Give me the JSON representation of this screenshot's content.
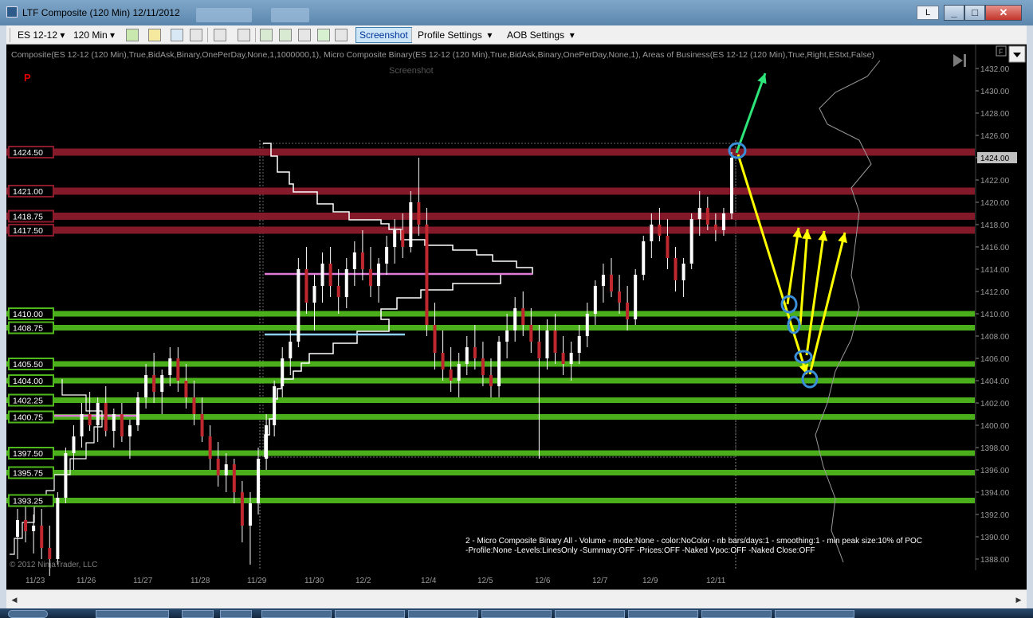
{
  "window": {
    "title": "LTF Composite (120 Min)  12/11/2012",
    "workspace_label": "L"
  },
  "toolbar": {
    "instrument": "ES 12-12",
    "interval": "120 Min",
    "screenshot": "Screenshot",
    "profile_settings": "Profile Settings",
    "aob_settings": "AOB Settings"
  },
  "chart": {
    "indicator_text": "Composite(ES 12-12 (120 Min),True,BidAsk,Binary,OnePerDay,None,1,1000000,1), Micro Composite Binary(ES 12-12 (120 Min),True,BidAsk,Binary,OnePerDay,None,1), Areas of Business(ES 12-12 (120 Min),True,Right,EStxt,False)",
    "tooltip_ghost": "Screenshot",
    "copyright": "© 2012 NinjaTrader, LLC",
    "note_line1": "2 - Micro Composite Binary All - Volume - mode:None  - color:NoColor - nb bars/days:1 - smoothing:1 - min peak size:10% of POC",
    "note_line2": "-Profile:None -Levels:LinesOnly -Summary:OFF -Prices:OFF -Naked Vpoc:OFF -Naked Close:OFF",
    "p_marker": "P",
    "panel_button": "F",
    "colors": {
      "resistance": "#8b1a2b",
      "support": "#4fb81c",
      "up_arrow": "#2ee57a",
      "yellow_arrow": "#ffff00",
      "circle": "#3a8fd8",
      "poc_pink": "#e07ad8",
      "poc_blue": "#8fd0f0"
    }
  },
  "chart_data": {
    "type": "candlestick",
    "yaxis": {
      "min": 1387,
      "max": 1432,
      "ticks": [
        "1432.00",
        "1430.00",
        "1428.00",
        "1426.00",
        "1424.00",
        "1422.00",
        "1420.00",
        "1418.00",
        "1416.00",
        "1414.00",
        "1412.00",
        "1410.00",
        "1408.00",
        "1406.00",
        "1404.00",
        "1402.00",
        "1400.00",
        "1398.00",
        "1396.00",
        "1394.00",
        "1392.00",
        "1390.00",
        "1388.00"
      ]
    },
    "current_price": "1424.00",
    "xaxis": {
      "labels": [
        "11/23",
        "11/26",
        "11/27",
        "11/28",
        "11/29",
        "11/30",
        "12/2",
        "12/4",
        "12/5",
        "12/6",
        "12/7",
        "12/9",
        "12/11"
      ]
    },
    "resistance_levels": [
      {
        "label": "1424.50",
        "value": 1424.5
      },
      {
        "label": "1421.00",
        "value": 1421.0
      },
      {
        "label": "1418.75",
        "value": 1418.75
      },
      {
        "label": "1417.50",
        "value": 1417.5
      }
    ],
    "support_levels": [
      {
        "label": "1410.00",
        "value": 1410.0
      },
      {
        "label": "1408.75",
        "value": 1408.75
      },
      {
        "label": "1405.50",
        "value": 1405.5
      },
      {
        "label": "1404.00",
        "value": 1404.0
      },
      {
        "label": "1402.25",
        "value": 1402.25
      },
      {
        "label": "1400.75",
        "value": 1400.75
      },
      {
        "label": "1397.50",
        "value": 1397.5
      },
      {
        "label": "1395.75",
        "value": 1395.75
      },
      {
        "label": "1393.25",
        "value": 1393.25
      }
    ],
    "candles": [
      {
        "o": 1390.0,
        "h": 1392.5,
        "l": 1388.0,
        "c": 1391.5
      },
      {
        "o": 1391.5,
        "h": 1393.0,
        "l": 1389.5,
        "c": 1390.5
      },
      {
        "o": 1390.5,
        "h": 1392.0,
        "l": 1388.5,
        "c": 1391.0
      },
      {
        "o": 1391.0,
        "h": 1392.5,
        "l": 1388.0,
        "c": 1389.0
      },
      {
        "o": 1389.0,
        "h": 1391.0,
        "l": 1386.5,
        "c": 1388.0
      },
      {
        "o": 1388.0,
        "h": 1394.0,
        "l": 1387.5,
        "c": 1393.5
      },
      {
        "o": 1393.5,
        "h": 1398.0,
        "l": 1393.0,
        "c": 1397.5
      },
      {
        "o": 1397.5,
        "h": 1400.0,
        "l": 1396.0,
        "c": 1399.0
      },
      {
        "o": 1399.0,
        "h": 1402.0,
        "l": 1398.0,
        "c": 1401.0
      },
      {
        "o": 1401.0,
        "h": 1403.0,
        "l": 1399.5,
        "c": 1400.0
      },
      {
        "o": 1400.0,
        "h": 1402.5,
        "l": 1398.5,
        "c": 1402.0
      },
      {
        "o": 1402.0,
        "h": 1403.5,
        "l": 1399.0,
        "c": 1399.5
      },
      {
        "o": 1399.5,
        "h": 1401.5,
        "l": 1398.0,
        "c": 1401.0
      },
      {
        "o": 1401.0,
        "h": 1402.0,
        "l": 1398.5,
        "c": 1399.0
      },
      {
        "o": 1399.0,
        "h": 1400.5,
        "l": 1397.0,
        "c": 1400.0
      },
      {
        "o": 1400.0,
        "h": 1403.0,
        "l": 1399.5,
        "c": 1402.5
      },
      {
        "o": 1402.5,
        "h": 1405.5,
        "l": 1401.5,
        "c": 1404.5
      },
      {
        "o": 1404.5,
        "h": 1406.5,
        "l": 1402.0,
        "c": 1403.0
      },
      {
        "o": 1403.0,
        "h": 1405.0,
        "l": 1401.0,
        "c": 1404.5
      },
      {
        "o": 1404.5,
        "h": 1407.0,
        "l": 1403.5,
        "c": 1406.0
      },
      {
        "o": 1406.0,
        "h": 1407.0,
        "l": 1403.0,
        "c": 1404.0
      },
      {
        "o": 1404.0,
        "h": 1405.5,
        "l": 1401.5,
        "c": 1402.5
      },
      {
        "o": 1402.5,
        "h": 1404.0,
        "l": 1400.0,
        "c": 1401.0
      },
      {
        "o": 1401.0,
        "h": 1402.5,
        "l": 1398.5,
        "c": 1399.0
      },
      {
        "o": 1399.0,
        "h": 1400.0,
        "l": 1396.0,
        "c": 1397.0
      },
      {
        "o": 1397.0,
        "h": 1398.5,
        "l": 1394.5,
        "c": 1395.5
      },
      {
        "o": 1395.5,
        "h": 1397.5,
        "l": 1394.0,
        "c": 1396.5
      },
      {
        "o": 1396.5,
        "h": 1397.0,
        "l": 1393.0,
        "c": 1394.0
      },
      {
        "o": 1394.0,
        "h": 1395.0,
        "l": 1389.5,
        "c": 1391.0
      },
      {
        "o": 1391.0,
        "h": 1394.0,
        "l": 1387.5,
        "c": 1393.0
      },
      {
        "o": 1393.0,
        "h": 1398.0,
        "l": 1392.0,
        "c": 1397.0
      },
      {
        "o": 1397.0,
        "h": 1401.0,
        "l": 1396.0,
        "c": 1400.0
      },
      {
        "o": 1400.0,
        "h": 1404.0,
        "l": 1399.0,
        "c": 1403.5
      },
      {
        "o": 1403.5,
        "h": 1407.0,
        "l": 1402.5,
        "c": 1406.0
      },
      {
        "o": 1406.0,
        "h": 1408.5,
        "l": 1404.5,
        "c": 1407.5
      },
      {
        "o": 1407.5,
        "h": 1415.0,
        "l": 1407.0,
        "c": 1414.0
      },
      {
        "o": 1414.0,
        "h": 1416.0,
        "l": 1410.0,
        "c": 1411.0
      },
      {
        "o": 1411.0,
        "h": 1413.5,
        "l": 1408.5,
        "c": 1412.5
      },
      {
        "o": 1412.5,
        "h": 1415.5,
        "l": 1411.0,
        "c": 1414.5
      },
      {
        "o": 1414.5,
        "h": 1416.0,
        "l": 1411.5,
        "c": 1412.5
      },
      {
        "o": 1412.5,
        "h": 1414.0,
        "l": 1410.0,
        "c": 1411.5
      },
      {
        "o": 1411.5,
        "h": 1415.0,
        "l": 1410.5,
        "c": 1414.0
      },
      {
        "o": 1414.0,
        "h": 1416.5,
        "l": 1412.5,
        "c": 1415.5
      },
      {
        "o": 1415.5,
        "h": 1417.5,
        "l": 1413.0,
        "c": 1414.0
      },
      {
        "o": 1414.0,
        "h": 1416.0,
        "l": 1411.5,
        "c": 1412.5
      },
      {
        "o": 1412.5,
        "h": 1415.0,
        "l": 1411.0,
        "c": 1414.5
      },
      {
        "o": 1414.5,
        "h": 1417.0,
        "l": 1413.5,
        "c": 1416.0
      },
      {
        "o": 1416.0,
        "h": 1418.5,
        "l": 1414.5,
        "c": 1417.5
      },
      {
        "o": 1417.5,
        "h": 1419.0,
        "l": 1415.0,
        "c": 1416.0
      },
      {
        "o": 1416.0,
        "h": 1421.0,
        "l": 1415.5,
        "c": 1420.0
      },
      {
        "o": 1420.0,
        "h": 1424.0,
        "l": 1417.0,
        "c": 1418.0
      },
      {
        "o": 1418.0,
        "h": 1419.5,
        "l": 1408.0,
        "c": 1409.0
      },
      {
        "o": 1409.0,
        "h": 1411.0,
        "l": 1405.0,
        "c": 1406.5
      },
      {
        "o": 1406.5,
        "h": 1408.5,
        "l": 1404.0,
        "c": 1405.0
      },
      {
        "o": 1405.0,
        "h": 1407.0,
        "l": 1403.0,
        "c": 1404.0
      },
      {
        "o": 1404.0,
        "h": 1406.5,
        "l": 1402.5,
        "c": 1405.5
      },
      {
        "o": 1405.5,
        "h": 1408.0,
        "l": 1404.5,
        "c": 1407.0
      },
      {
        "o": 1407.0,
        "h": 1409.0,
        "l": 1405.0,
        "c": 1406.0
      },
      {
        "o": 1406.0,
        "h": 1407.5,
        "l": 1403.5,
        "c": 1404.5
      },
      {
        "o": 1404.5,
        "h": 1406.0,
        "l": 1402.5,
        "c": 1403.5
      },
      {
        "o": 1403.5,
        "h": 1408.0,
        "l": 1402.5,
        "c": 1407.5
      },
      {
        "o": 1407.5,
        "h": 1410.0,
        "l": 1406.0,
        "c": 1408.5
      },
      {
        "o": 1408.5,
        "h": 1411.5,
        "l": 1407.5,
        "c": 1410.5
      },
      {
        "o": 1410.5,
        "h": 1412.0,
        "l": 1408.0,
        "c": 1409.0
      },
      {
        "o": 1409.0,
        "h": 1410.5,
        "l": 1406.5,
        "c": 1407.5
      },
      {
        "o": 1407.5,
        "h": 1409.0,
        "l": 1397.0,
        "c": 1406.0
      },
      {
        "o": 1406.0,
        "h": 1409.5,
        "l": 1405.0,
        "c": 1408.5
      },
      {
        "o": 1408.5,
        "h": 1410.0,
        "l": 1405.5,
        "c": 1406.5
      },
      {
        "o": 1406.5,
        "h": 1408.0,
        "l": 1404.5,
        "c": 1405.5
      },
      {
        "o": 1405.5,
        "h": 1407.5,
        "l": 1404.0,
        "c": 1406.5
      },
      {
        "o": 1406.5,
        "h": 1409.0,
        "l": 1405.5,
        "c": 1408.0
      },
      {
        "o": 1408.0,
        "h": 1411.0,
        "l": 1407.0,
        "c": 1410.0
      },
      {
        "o": 1410.0,
        "h": 1413.0,
        "l": 1409.0,
        "c": 1412.5
      },
      {
        "o": 1412.5,
        "h": 1414.5,
        "l": 1411.0,
        "c": 1413.5
      },
      {
        "o": 1413.5,
        "h": 1415.0,
        "l": 1411.5,
        "c": 1412.0
      },
      {
        "o": 1412.0,
        "h": 1413.5,
        "l": 1410.0,
        "c": 1411.0
      },
      {
        "o": 1411.0,
        "h": 1412.5,
        "l": 1408.5,
        "c": 1409.5
      },
      {
        "o": 1409.5,
        "h": 1414.0,
        "l": 1409.0,
        "c": 1413.5
      },
      {
        "o": 1413.5,
        "h": 1417.0,
        "l": 1413.0,
        "c": 1416.5
      },
      {
        "o": 1416.5,
        "h": 1419.0,
        "l": 1415.0,
        "c": 1418.0
      },
      {
        "o": 1418.0,
        "h": 1419.5,
        "l": 1416.5,
        "c": 1417.0
      },
      {
        "o": 1417.0,
        "h": 1418.5,
        "l": 1414.0,
        "c": 1415.0
      },
      {
        "o": 1415.0,
        "h": 1416.0,
        "l": 1412.0,
        "c": 1413.0
      },
      {
        "o": 1413.0,
        "h": 1415.0,
        "l": 1411.5,
        "c": 1414.5
      },
      {
        "o": 1414.5,
        "h": 1419.0,
        "l": 1414.0,
        "c": 1418.5
      },
      {
        "o": 1418.5,
        "h": 1421.0,
        "l": 1417.0,
        "c": 1419.5
      },
      {
        "o": 1419.5,
        "h": 1420.5,
        "l": 1417.5,
        "c": 1418.0
      },
      {
        "o": 1418.0,
        "h": 1419.0,
        "l": 1416.5,
        "c": 1417.5
      },
      {
        "o": 1417.5,
        "h": 1419.5,
        "l": 1417.0,
        "c": 1419.0
      },
      {
        "o": 1419.0,
        "h": 1424.5,
        "l": 1418.5,
        "c": 1424.0
      }
    ]
  }
}
